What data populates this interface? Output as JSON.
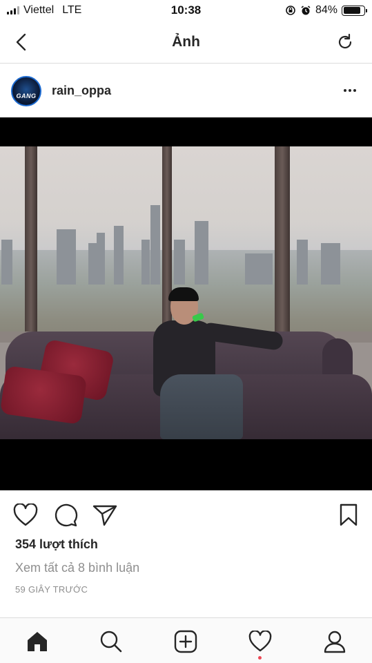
{
  "status_bar": {
    "carrier": "Viettel",
    "network": "LTE",
    "time": "10:38",
    "battery_percent": "84%",
    "battery_level": 0.84
  },
  "nav": {
    "title": "Ảnh",
    "back_icon": "chevron-left-icon",
    "refresh_icon": "refresh-icon"
  },
  "post": {
    "username": "rain_oppa",
    "avatar_text": "GANG",
    "more_icon": "ellipsis-icon",
    "image_icon": "photo-image"
  },
  "actions": {
    "like_icon": "heart-icon",
    "comment_icon": "comment-icon",
    "share_icon": "send-icon",
    "save_icon": "bookmark-icon"
  },
  "meta": {
    "likes": "354 lượt thích",
    "view_comments": "Xem tất cả 8 bình luận",
    "time_ago": "59 GIÂY TRƯỚC"
  },
  "tab_bar": {
    "items": [
      "home-icon",
      "search-icon",
      "add-post-icon",
      "activity-heart-icon",
      "profile-icon"
    ],
    "active": "home-icon",
    "notification_dot_color": "#ed4956"
  },
  "colors": {
    "text": "#262626",
    "secondary_text": "#8e8e8e",
    "divider": "#dbdbdb"
  }
}
